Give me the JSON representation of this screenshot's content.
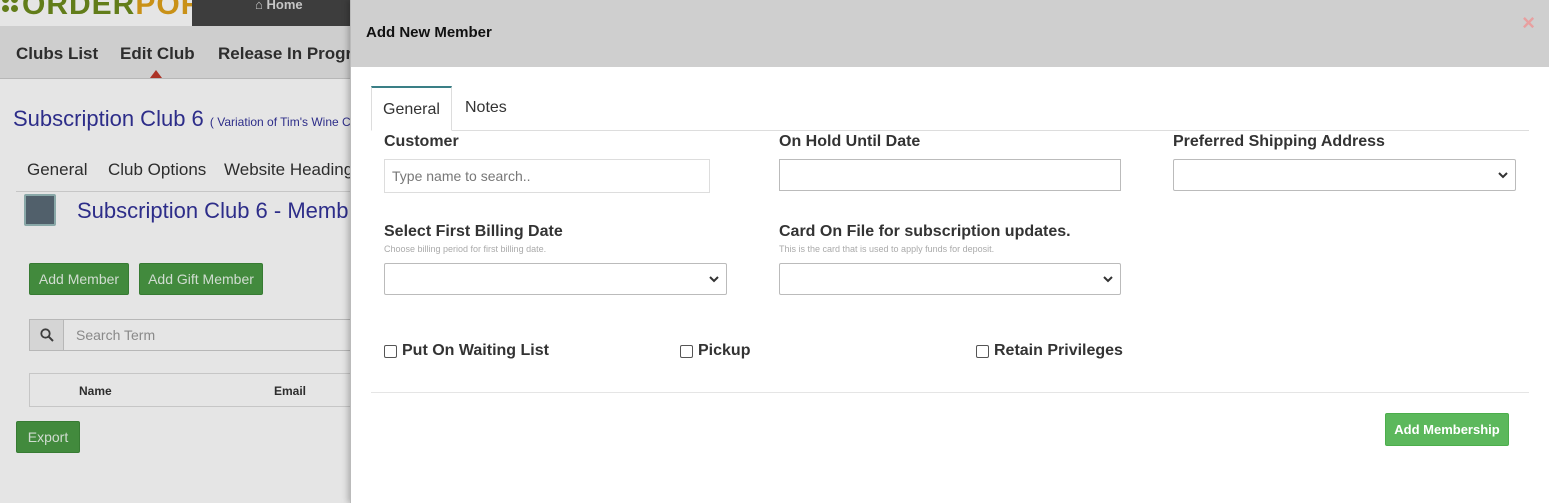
{
  "background": {
    "logo": {
      "text_part_a": "ORDER",
      "text_part_b": "PORT"
    },
    "home_tab": "Home",
    "subnav": [
      "Clubs List",
      "Edit Club",
      "Release In Progre"
    ],
    "club_title": "Subscription Club 6",
    "club_subtitle": "( Variation of Tim's Wine C",
    "club_tabs": [
      "General",
      "Club Options",
      "Website Heading"
    ],
    "member_title": "Subscription Club 6 - Memb",
    "buttons": {
      "add_member": "Add Member",
      "add_gift_member": "Add Gift Member",
      "export": "Export"
    },
    "search_placeholder": "Search Term",
    "table_headers": [
      "Name",
      "Email"
    ]
  },
  "modal": {
    "title": "Add New Member",
    "close_glyph": "×",
    "tabs": [
      {
        "label": "General",
        "active": true
      },
      {
        "label": "Notes",
        "active": false
      }
    ],
    "fields": {
      "customer": {
        "label": "Customer",
        "placeholder": "Type name to search..",
        "value": ""
      },
      "on_hold_until": {
        "label": "On Hold Until Date",
        "value": ""
      },
      "preferred_shipping": {
        "label": "Preferred Shipping Address",
        "value": ""
      },
      "first_billing": {
        "label": "Select First Billing Date",
        "help": "Choose billing period for first billing date.",
        "value": ""
      },
      "card_on_file": {
        "label": "Card On File for subscription updates.",
        "help": "This is the card that is used to apply funds for deposit.",
        "value": ""
      }
    },
    "checkboxes": [
      {
        "label": "Put On Waiting List",
        "checked": false
      },
      {
        "label": "Pickup",
        "checked": false
      },
      {
        "label": "Retain Privileges",
        "checked": false
      }
    ],
    "submit_label": "Add Membership"
  },
  "colors": {
    "accent_green": "#5cb85c",
    "header_gray": "#cfcfcf",
    "tab_accent": "#3a7f86",
    "title_purple": "#333399"
  },
  "icons": [
    "home-icon",
    "search-icon",
    "close-icon",
    "chevron-down-icon",
    "avatar-icon"
  ]
}
